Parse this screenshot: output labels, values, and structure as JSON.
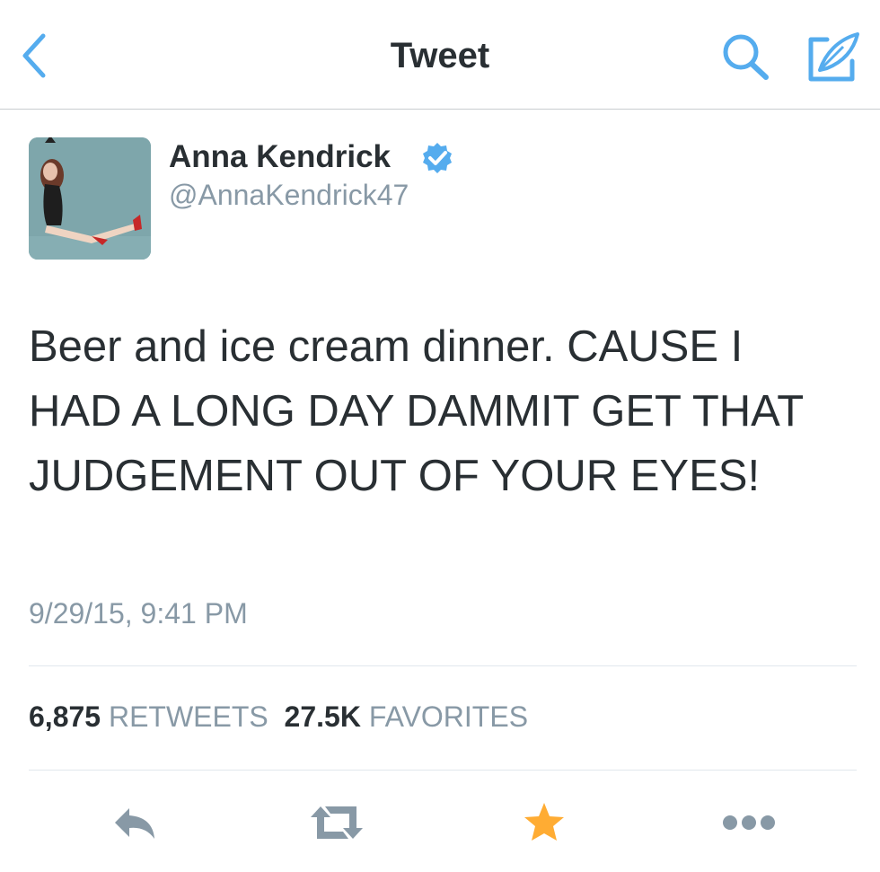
{
  "nav": {
    "title": "Tweet"
  },
  "tweet": {
    "author_name": "Anna Kendrick",
    "author_handle": "@AnnaKendrick47",
    "verified": true,
    "text": "Beer and ice cream dinner. CAUSE I HAD A LONG DAY DAMMIT GET THAT JUDGEMENT OUT OF YOUR EYES!",
    "timestamp": "9/29/15, 9:41 PM"
  },
  "stats": {
    "retweets_count": "6,875",
    "retweets_label": "RETWEETS",
    "favorites_count": "27.5K",
    "favorites_label": "FAVORITES"
  },
  "actions": [
    {
      "name": "reply",
      "icon": "reply-icon"
    },
    {
      "name": "retweet",
      "icon": "retweet-icon"
    },
    {
      "name": "favorite",
      "icon": "star-icon",
      "active": true
    },
    {
      "name": "more",
      "icon": "more-icon"
    }
  ],
  "colors": {
    "accent": "#55acee",
    "favorite": "#ffac33",
    "text": "#292f33",
    "secondary": "#8899a6",
    "icon_gray": "#8899a6"
  }
}
